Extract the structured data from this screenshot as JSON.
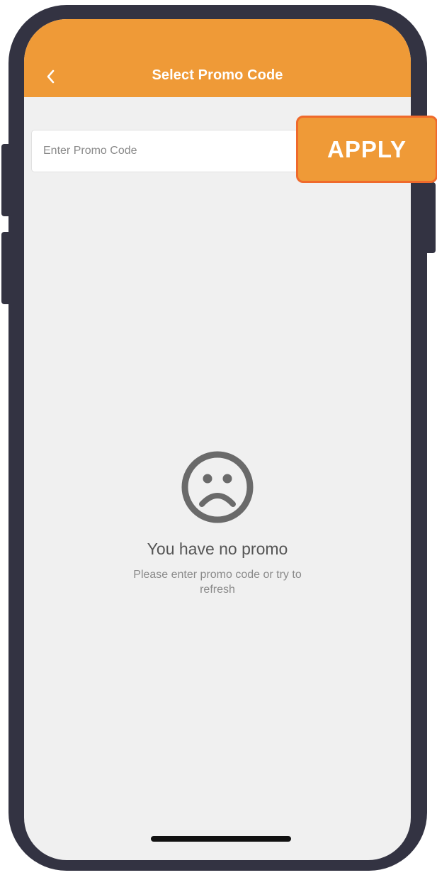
{
  "header": {
    "title": "Select Promo Code",
    "back_icon": "chevron-left-icon"
  },
  "promo": {
    "placeholder": "Enter Promo Code",
    "value": "",
    "apply_label": "APPLY"
  },
  "empty_state": {
    "icon": "sad-face-icon",
    "title": "You have no promo",
    "subtitle": "Please enter promo code or try to refresh"
  },
  "colors": {
    "accent": "#ef9a37",
    "apply_border": "#ef6a2c",
    "screen_background": "#f0f0f0",
    "device_frame": "#333342"
  }
}
